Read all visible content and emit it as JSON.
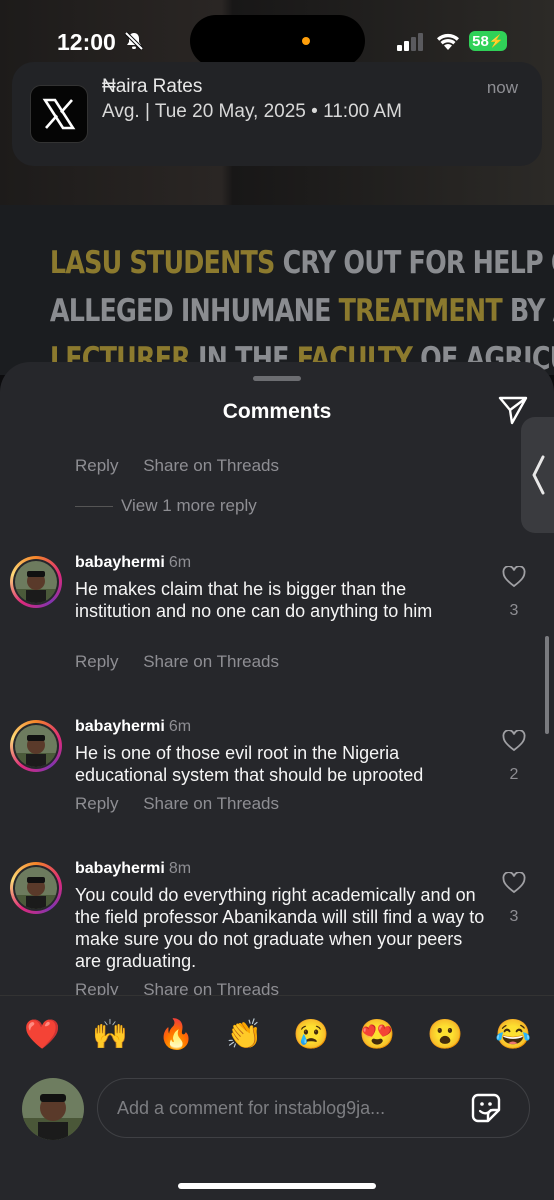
{
  "status_bar": {
    "time": "12:00",
    "battery": "58"
  },
  "notification": {
    "app_icon": "x-logo-icon",
    "title": "₦aira Rates",
    "body": "Avg. | Tue 20 May, 2025 • 11:00 AM",
    "time": "now"
  },
  "post": {
    "headline_lines": [
      [
        {
          "t": "LASU STUDENTS",
          "hl": true
        },
        {
          "t": " CRY OUT FOR HELP OVER",
          "hl": false
        }
      ],
      [
        {
          "t": "ALLEGED INHUMANE ",
          "hl": false
        },
        {
          "t": "TREATMENT",
          "hl": true
        },
        {
          "t": " BY A",
          "hl": false
        }
      ],
      [
        {
          "t": "LECTURER",
          "hl": true
        },
        {
          "t": " IN THE ",
          "hl": false
        },
        {
          "t": "FACULTY",
          "hl": true
        },
        {
          "t": " OF AGRICULTURE",
          "hl": false
        }
      ]
    ]
  },
  "sheet": {
    "title": "Comments"
  },
  "actions": {
    "reply": "Reply",
    "share": "Share on Threads",
    "view_more": "View 1 more reply"
  },
  "comments": [
    {
      "user": "babayhermi",
      "time": "6m",
      "text": "He makes claim that he is bigger than the institution and no one can do anything to him",
      "likes": "3"
    },
    {
      "user": "babayhermi",
      "time": "6m",
      "text": "He is one of those evil root in the Nigeria educational system that should be uprooted",
      "likes": "2"
    },
    {
      "user": "babayhermi",
      "time": "8m",
      "text": "You could do everything right academically and on the field professor Abanikanda will still find a way to make sure you do not graduate when your peers are graduating.",
      "likes": "3"
    }
  ],
  "emojis": [
    "❤️",
    "🙌",
    "🔥",
    "👏",
    "😢",
    "😍",
    "😮",
    "😂"
  ],
  "input": {
    "placeholder": "Add a comment for instablog9ja..."
  }
}
